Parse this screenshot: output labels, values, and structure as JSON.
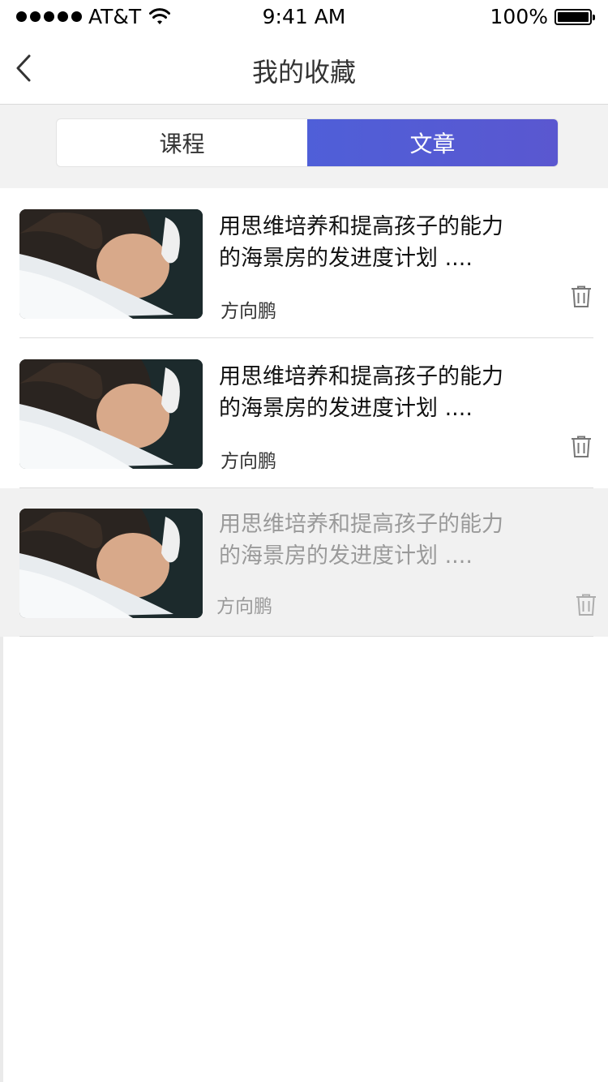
{
  "status_bar": {
    "carrier": "AT&T",
    "time": "9:41 AM",
    "battery": "100%"
  },
  "nav": {
    "title": "我的收藏",
    "back_icon": "chevron-left-icon"
  },
  "tabs": [
    {
      "label": "课程",
      "active": false
    },
    {
      "label": "文章",
      "active": true
    }
  ],
  "articles": [
    {
      "title_line1": "用思维培养和提高孩子的能力",
      "title_line2": "的海景房的发进度计划 ....",
      "author": "方向鹏",
      "icon": "trash-icon"
    },
    {
      "title_line1": "用思维培养和提高孩子的能力",
      "title_line2": "的海景房的发进度计划 ....",
      "author": "方向鹏",
      "icon": "trash-icon"
    },
    {
      "title_line1": "用思维培养和提高孩子的能力",
      "title_line2": "的海景房的发进度计划 ....",
      "author": "方向鹏",
      "icon": "trash-icon"
    }
  ],
  "colors": {
    "accent": "#5559d4",
    "divider": "#dcdcdc",
    "background_gray": "#f2f2f2"
  }
}
